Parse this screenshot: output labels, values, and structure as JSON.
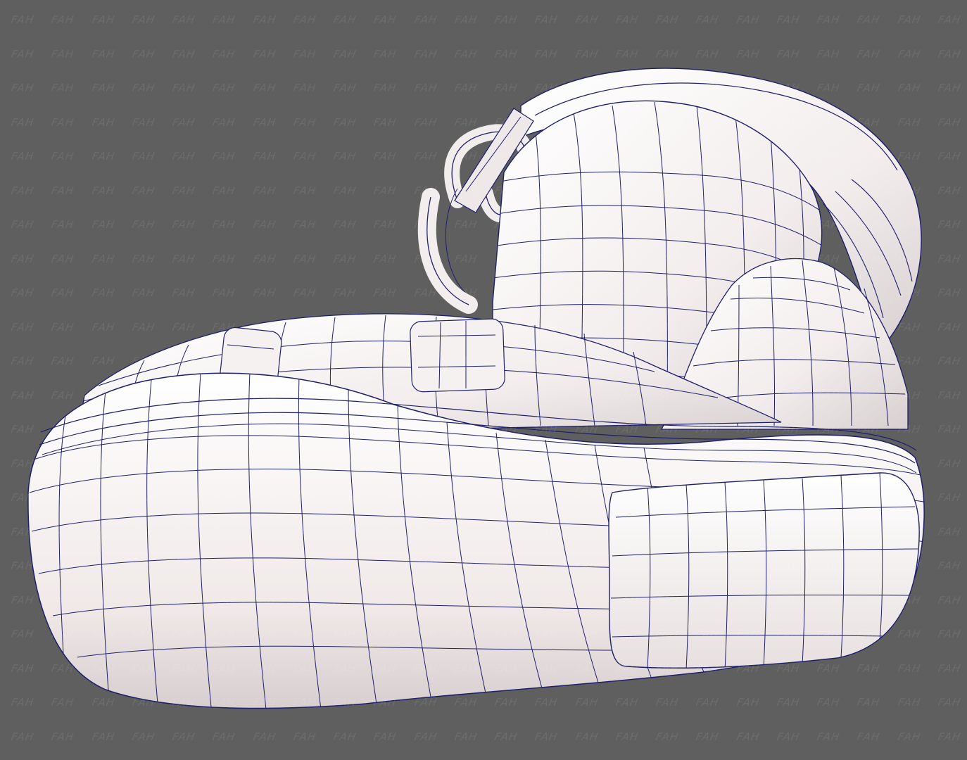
{
  "viewport": {
    "background_color": "#5f5f5f",
    "model_fill_color": "#f6f1f1",
    "wire_color": "#1e1f6b",
    "shadow_color": "#cfc8c8"
  },
  "watermark": {
    "text": "FAH",
    "rows": 22,
    "columns": 24
  }
}
